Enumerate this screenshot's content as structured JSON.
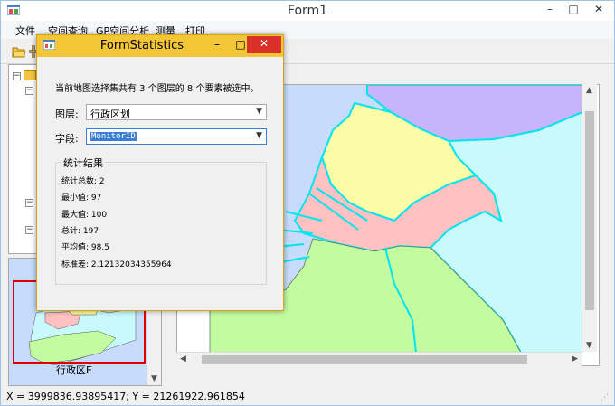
{
  "main_window": {
    "title": "Form1",
    "controls": {
      "minimize": "–",
      "maximize": "□",
      "close": "✕"
    }
  },
  "menu": {
    "items": [
      "文件",
      "空间查询",
      "GP空间分析",
      "测量",
      "打印"
    ]
  },
  "toolbar": {
    "icons": [
      "open-folder-icon",
      "add-data-icon"
    ]
  },
  "overview": {
    "label": "行政区E"
  },
  "status_bar": {
    "coords": "X = 3999836.93895417;  Y = 21261922.961854"
  },
  "dialog": {
    "title": "FormStatistics",
    "controls": {
      "minimize": "–",
      "maximize": "□",
      "close": "✕"
    },
    "summary": "当前地图选择集共有 3 个图层的 8 个要素被选中。",
    "layer_label": "图层:",
    "layer_value": "行政区划",
    "field_label": "字段:",
    "field_value": "MonitorID",
    "group_title": "统计结果",
    "stats": [
      "统计总数:  2",
      "最小值: 97",
      "最大值: 100",
      "总计:  197",
      "平均值:  98.5",
      "标准差:  2.12132034355964"
    ]
  },
  "colors": {
    "dialog_title_bar": "#f2c637",
    "close_button": "#d9302a",
    "selection_outline": "#00e5ee",
    "overview_extent": "#e00000",
    "region_yellow": "#fdfca6",
    "region_pink": "#ffc1c1",
    "region_green": "#c3fca0",
    "region_cyan": "#c8fafc",
    "region_purple": "#c8b4fa",
    "water_blue": "#c6dcfa"
  }
}
